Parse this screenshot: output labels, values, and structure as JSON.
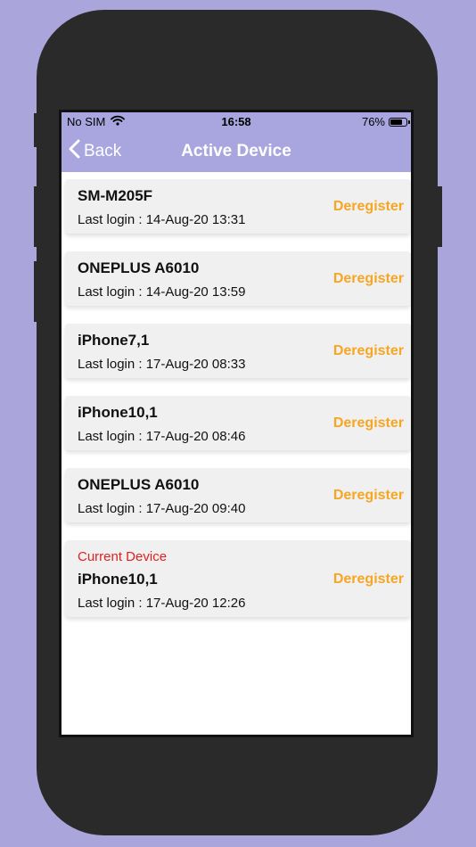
{
  "status_bar": {
    "carrier": "No SIM",
    "wifi_icon": "wifi-icon",
    "time": "16:58",
    "battery_percent": "76%",
    "battery_level": 0.76
  },
  "nav": {
    "back_label": "Back",
    "back_icon": "chevron-left-icon",
    "title": "Active Device"
  },
  "colors": {
    "header_bg": "#a9a5df",
    "page_bg": "#aaa6db",
    "action": "#f5a623",
    "current_device": "#e22020"
  },
  "devices": [
    {
      "name": "SM-M205F",
      "last_login": "Last login : 14-Aug-20 13:31",
      "action": "Deregister"
    },
    {
      "name": "ONEPLUS A6010",
      "last_login": "Last login : 14-Aug-20 13:59",
      "action": "Deregister"
    },
    {
      "name": "iPhone7,1",
      "last_login": "Last login : 17-Aug-20 08:33",
      "action": "Deregister"
    },
    {
      "name": "iPhone10,1",
      "last_login": "Last login : 17-Aug-20 08:46",
      "action": "Deregister"
    },
    {
      "name": "ONEPLUS A6010",
      "last_login": "Last login : 17-Aug-20 09:40",
      "action": "Deregister"
    },
    {
      "current_label": "Current Device",
      "name": "iPhone10,1",
      "last_login": "Last login : 17-Aug-20 12:26",
      "action": "Deregister"
    }
  ]
}
